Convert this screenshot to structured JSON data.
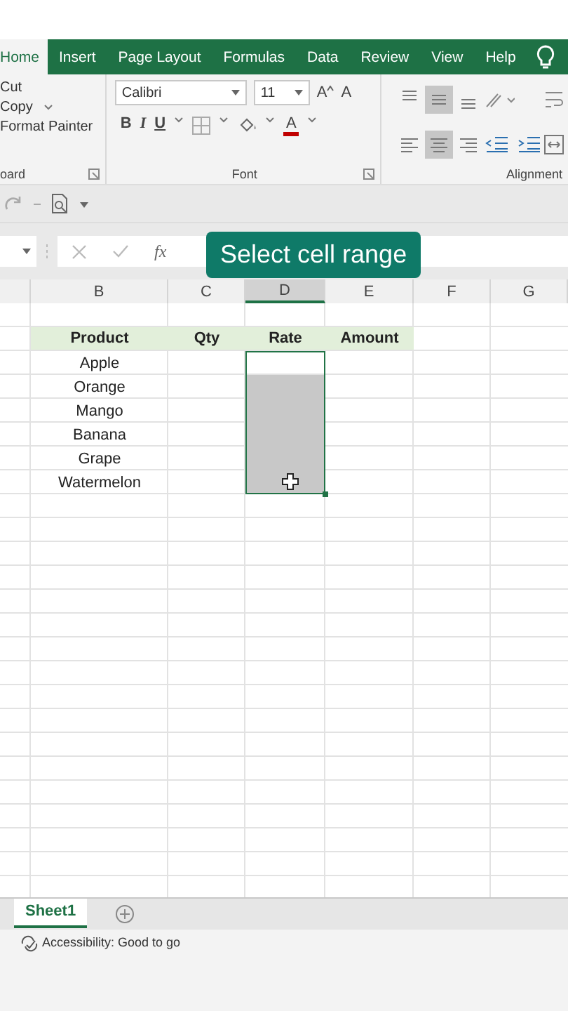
{
  "ribbon_tabs": [
    {
      "label": "Home",
      "selected": true
    },
    {
      "label": "Insert",
      "selected": false
    },
    {
      "label": "Page Layout",
      "selected": false
    },
    {
      "label": "Formulas",
      "selected": false
    },
    {
      "label": "Data",
      "selected": false
    },
    {
      "label": "Review",
      "selected": false
    },
    {
      "label": "View",
      "selected": false
    },
    {
      "label": "Help",
      "selected": false
    }
  ],
  "clipboard": {
    "items": [
      "Cut",
      "Copy",
      "Format Painter"
    ],
    "label": "oard"
  },
  "font": {
    "name": "Calibri",
    "size": "11",
    "grow": "A",
    "shrink": "A",
    "bold": "B",
    "italic": "I",
    "underline": "U",
    "color_letter": "A",
    "label": "Font"
  },
  "alignment": {
    "buttons": [
      {
        "kind": "top",
        "selected": false
      },
      {
        "kind": "middle",
        "selected": true
      },
      {
        "kind": "bottom",
        "selected": false
      },
      {
        "kind": "left",
        "selected": false
      },
      {
        "kind": "center",
        "selected": true
      },
      {
        "kind": "right",
        "selected": false
      }
    ],
    "label": "Alignment"
  },
  "formula_bar": {
    "fx": "fx"
  },
  "callout": "Select cell range",
  "columns": [
    {
      "label": "B",
      "selected": false
    },
    {
      "label": "C",
      "selected": false
    },
    {
      "label": "D",
      "selected": true
    },
    {
      "label": "E",
      "selected": false
    },
    {
      "label": "F",
      "selected": false
    },
    {
      "label": "G",
      "selected": false
    }
  ],
  "table": {
    "headers": [
      "Product",
      "Qty",
      "Rate",
      "Amount"
    ],
    "rows": [
      {
        "product": "Apple",
        "selected": true,
        "active": true
      },
      {
        "product": "Orange",
        "selected": true,
        "active": false
      },
      {
        "product": "Mango",
        "selected": true,
        "active": false
      },
      {
        "product": "Banana",
        "selected": true,
        "active": false
      },
      {
        "product": "Grape",
        "selected": true,
        "active": false
      },
      {
        "product": "Watermelon",
        "selected": true,
        "active": false
      }
    ]
  },
  "sheet_tabs": [
    {
      "label": "Sheet1",
      "selected": true
    }
  ],
  "status_bar": {
    "text": "Accessibility: Good to go"
  }
}
